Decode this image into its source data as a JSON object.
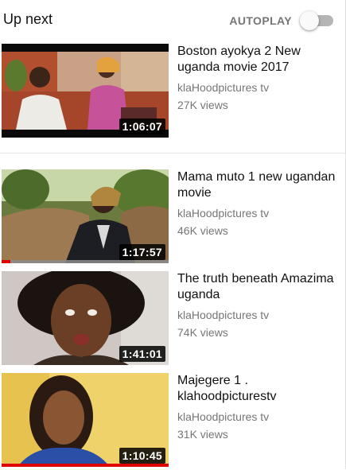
{
  "header": {
    "title": "Up next",
    "autoplay_label": "AUTOPLAY",
    "autoplay_on": false
  },
  "videos": [
    {
      "title": "Boston ayokya 2 New uganda movie 2017",
      "channel": "klaHoodpictures tv",
      "views": "27K views",
      "duration": "1:06:07",
      "watched_fraction": 0
    },
    {
      "title": "Mama muto 1 new ugandan movie",
      "channel": "klaHoodpictures tv",
      "views": "46K views",
      "duration": "1:17:57",
      "watched_fraction": 0.05
    },
    {
      "title": "The truth beneath Amazima uganda",
      "channel": "klaHoodpictures tv",
      "views": "74K views",
      "duration": "1:41:01",
      "watched_fraction": 0
    },
    {
      "title": "Majegere 1 . klahoodpicturestv",
      "channel": "klaHoodpictures tv",
      "views": "31K views",
      "duration": "1:10:45",
      "watched_fraction": 1
    }
  ],
  "colors": {
    "progress": "#e00000",
    "meta_text": "#767676"
  }
}
